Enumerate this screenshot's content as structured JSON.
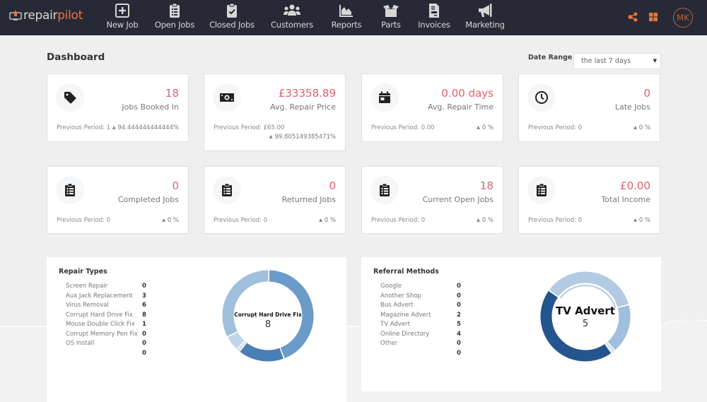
{
  "app": {
    "logo_part1": "repair",
    "logo_part2": "pilot",
    "user_initials": "MK"
  },
  "nav": [
    {
      "label": "New Job",
      "icon": "plus-square-icon"
    },
    {
      "label": "Open Jobs",
      "icon": "clipboard-list-icon"
    },
    {
      "label": "Closed Jobs",
      "icon": "clipboard-check-icon"
    },
    {
      "label": "Customers",
      "icon": "users-icon"
    },
    {
      "label": "Reports",
      "icon": "area-chart-icon"
    },
    {
      "label": "Parts",
      "icon": "open-box-icon"
    },
    {
      "label": "Invoices",
      "icon": "invoice-icon"
    },
    {
      "label": "Marketing",
      "icon": "megaphone-icon"
    }
  ],
  "header_tools": [
    {
      "icon": "share-nodes-icon"
    },
    {
      "icon": "grid-icon"
    }
  ],
  "colors": {
    "topbar": "#272a36",
    "accent_orange": "#e8743b",
    "value_red": "#e0606e",
    "donut_palette": [
      "#a8c3dd",
      "#6b9bc9",
      "#4a7fb5",
      "#2a5a93",
      "#c6d8ea"
    ]
  },
  "dashboard": {
    "title": "Dashboard",
    "date_range_label": "Date Range",
    "date_range_value": "the last 7 days",
    "cards": [
      {
        "icon": "tag-icon",
        "value": "18",
        "label": "Jobs Booked In",
        "previous": "Previous Period: 1",
        "change": "94.444444444444%"
      },
      {
        "icon": "money-bill-icon",
        "value": "£33358.89",
        "label": "Avg. Repair Price",
        "previous": "Previous Period: £65.00",
        "change": "99.805149385471%"
      },
      {
        "icon": "calendar-icon",
        "value": "0.00 days",
        "label": "Avg. Repair Time",
        "previous": "Previous Period: 0.00",
        "change": "0 %"
      },
      {
        "icon": "clock-icon",
        "value": "0",
        "label": "Late Jobs",
        "previous": "Previous Period: 0",
        "change": "0 %"
      },
      {
        "icon": "clipboard-list-icon",
        "value": "0",
        "label": "Completed Jobs",
        "previous": "Previous Period: 0",
        "change": "0 %"
      },
      {
        "icon": "clipboard-list-icon",
        "value": "0",
        "label": "Returned Jobs",
        "previous": "Previous Period: 0",
        "change": "0 %"
      },
      {
        "icon": "clipboard-list-icon",
        "value": "18",
        "label": "Current Open Jobs",
        "previous": "Previous Period: 0",
        "change": "0 %"
      },
      {
        "icon": "clipboard-list-icon",
        "value": "£0.00",
        "label": "Total Income",
        "previous": "Previous Period: 0",
        "change": "0 %"
      }
    ]
  },
  "repair_types": {
    "title": "Repair Types",
    "rows": [
      {
        "name": "Screen Repair",
        "value": "0"
      },
      {
        "name": "Aux Jack Replacement",
        "value": "3"
      },
      {
        "name": "Virus Removal",
        "value": "6"
      },
      {
        "name": "Corrupt Hard Drive Fix",
        "value": "8"
      },
      {
        "name": "Mouse Double Click Fix",
        "value": "1"
      },
      {
        "name": "Corrupt Memory Pen Fix",
        "value": "0"
      },
      {
        "name": "OS Install",
        "value": "0"
      },
      {
        "name": "",
        "value": "0"
      }
    ],
    "center_label": "Corrupt Hard Drive Fix",
    "center_value": "8"
  },
  "referral_methods": {
    "title": "Referral Methods",
    "rows": [
      {
        "name": "Google",
        "value": "0"
      },
      {
        "name": "Another Shop",
        "value": "0"
      },
      {
        "name": "Bus Advert",
        "value": "0"
      },
      {
        "name": "Magazine Advert",
        "value": "2"
      },
      {
        "name": "TV Advert",
        "value": "5"
      },
      {
        "name": "Online Directory",
        "value": "4"
      },
      {
        "name": "Other",
        "value": "0"
      },
      {
        "name": "",
        "value": "0"
      }
    ],
    "center_label": "TV Advert",
    "center_value": "5"
  },
  "chart_data": [
    {
      "type": "pie",
      "title": "Repair Types",
      "categories": [
        "Screen Repair",
        "Aux Jack Replacement",
        "Virus Removal",
        "Corrupt Hard Drive Fix",
        "Mouse Double Click Fix",
        "Corrupt Memory Pen Fix",
        "OS Install",
        ""
      ],
      "values": [
        0,
        3,
        6,
        8,
        1,
        0,
        0,
        0
      ],
      "highlighted": "Corrupt Hard Drive Fix",
      "donut": true
    },
    {
      "type": "pie",
      "title": "Referral Methods",
      "categories": [
        "Google",
        "Another Shop",
        "Bus Advert",
        "Magazine Advert",
        "TV Advert",
        "Online Directory",
        "Other",
        ""
      ],
      "values": [
        0,
        0,
        0,
        2,
        5,
        4,
        0,
        0
      ],
      "highlighted": "TV Advert",
      "donut": true
    }
  ]
}
